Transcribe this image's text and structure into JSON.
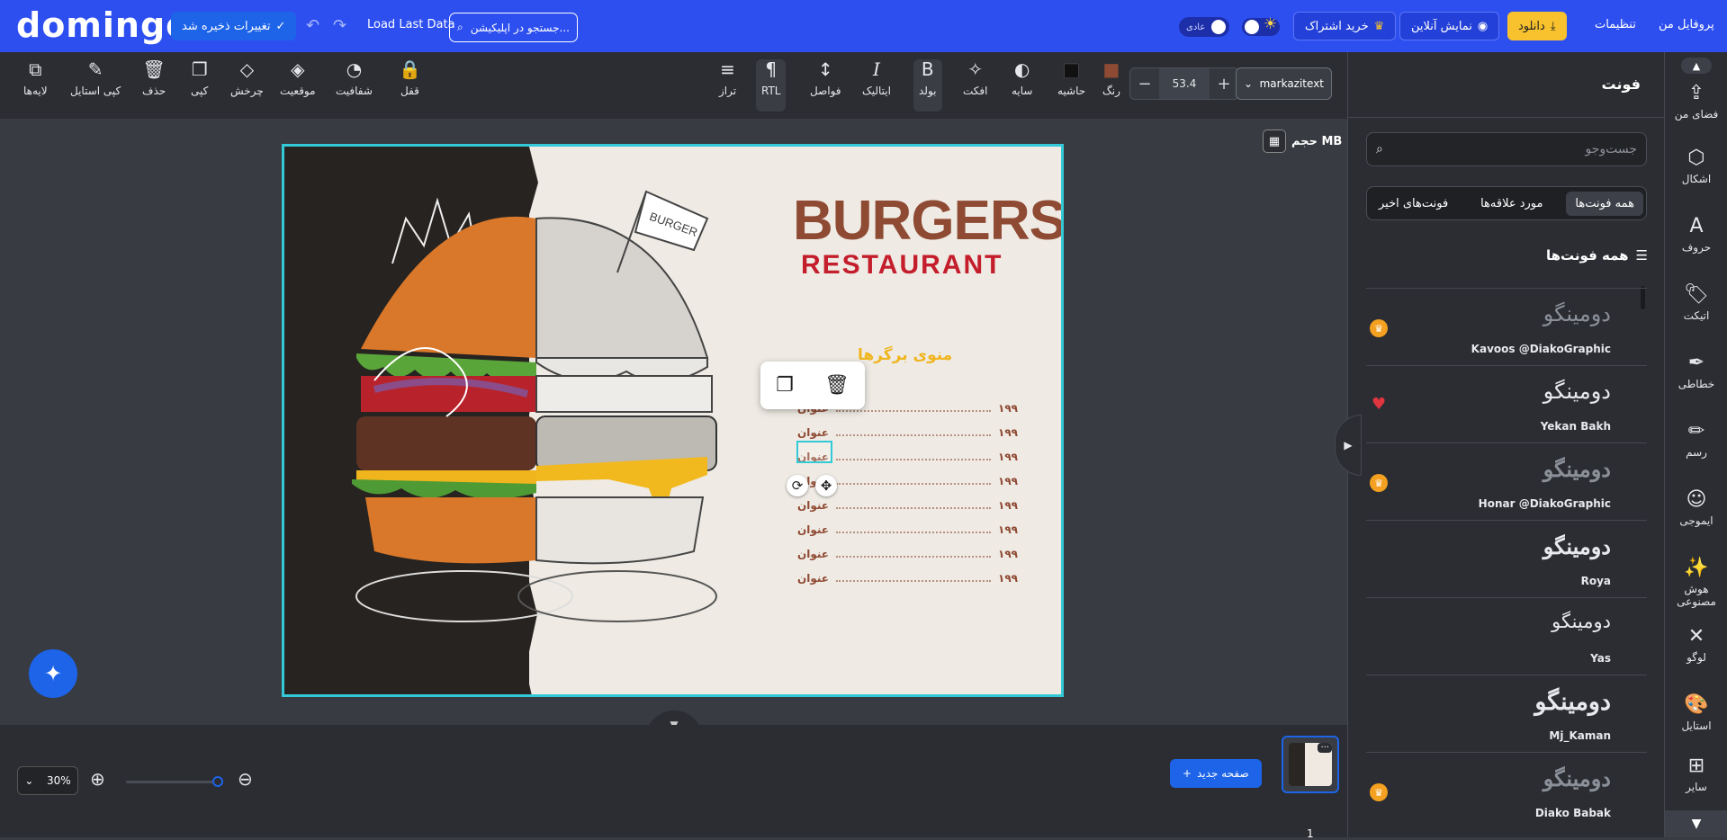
{
  "topbar": {
    "logo": "domingo",
    "save_label": "تغییرات ذخیره شد",
    "save_icon": "✓",
    "undo_icon": "↶",
    "redo_icon": "↷",
    "load_label": "Load Last Data",
    "search_placeholder": "جستجو در اپلیکیشن...",
    "theme_label": "عادی",
    "subscribe_label": "خرید اشتراک",
    "live_label": "نمایش آنلاین",
    "download_label": "دانلود",
    "settings_label": "تنظیمات",
    "profile_label": "پروفایل من",
    "colors": {
      "bar": "#2d4ff0",
      "download": "#f7c22d"
    }
  },
  "toolbar": {
    "tools_left": [
      {
        "name": "layers",
        "icon": "⧉",
        "label": "لایه‌ها"
      },
      {
        "name": "copy-style",
        "icon": "✎",
        "label": "کپی استایل"
      },
      {
        "name": "delete",
        "icon": "🗑",
        "label": "حذف"
      },
      {
        "name": "copy",
        "icon": "❐",
        "label": "کپی"
      },
      {
        "name": "rotate",
        "icon": "◇",
        "label": "چرخش"
      },
      {
        "name": "position",
        "icon": "◈",
        "label": "موقعیت"
      },
      {
        "name": "opacity",
        "icon": "◔",
        "label": "شفافیت"
      },
      {
        "name": "lock",
        "icon": "🔒",
        "label": "قفل"
      }
    ],
    "tools_right": [
      {
        "name": "align",
        "icon": "≡",
        "label": "تراز"
      },
      {
        "name": "rtl",
        "icon": "¶",
        "label": "RTL"
      },
      {
        "name": "spacing",
        "icon": "↕",
        "label": "فواصل"
      },
      {
        "name": "italic",
        "icon": "I",
        "label": "ایتالیک"
      },
      {
        "name": "bold",
        "icon": "B",
        "label": "بولد"
      },
      {
        "name": "effect",
        "icon": "✧",
        "label": "افکت"
      },
      {
        "name": "shadow",
        "icon": "◐",
        "label": "سایه"
      },
      {
        "name": "border",
        "icon": "■",
        "label": "حاشیه"
      },
      {
        "name": "color",
        "icon": "■",
        "label": "رنگ"
      }
    ],
    "font_size": "53.4",
    "font_name": "markazitext",
    "text_color": "#8f4a33"
  },
  "canvas": {
    "size_label": "حجم MB",
    "title_main": "BURGERS",
    "title_sub": "RESTAURANT",
    "menu_title": "منوی برگرها",
    "menu_rows": [
      {
        "label": "عنوان",
        "price": "۱۹۹"
      },
      {
        "label": "عنوان",
        "price": "۱۹۹"
      },
      {
        "label": "عنوان",
        "price": "۱۹۹"
      },
      {
        "label": "عنوان",
        "price": "۱۹۹"
      },
      {
        "label": "عنوان",
        "price": "۱۹۹"
      },
      {
        "label": "عنوان",
        "price": "۱۹۹"
      },
      {
        "label": "عنوان",
        "price": "۱۹۹"
      },
      {
        "label": "عنوان",
        "price": "۱۹۹"
      }
    ],
    "flag_text": "BURGER",
    "colors": {
      "title": "#8f4a33",
      "subtitle": "#c41d2b",
      "menu_title": "#f0b51d",
      "selection": "#33c9d6"
    }
  },
  "bottom": {
    "zoom_value": "30%",
    "new_page_label": "صفحه جدید",
    "page_number": "1",
    "thumb_more": "···"
  },
  "panel": {
    "title": "فونت",
    "search_placeholder": "جست‌وجو",
    "tabs": [
      "همه فونت‌ها",
      "مورد علاقه‌ها",
      "فونت‌های اخیر"
    ],
    "section_title": "همه فونت‌ها",
    "fonts": [
      {
        "sample": "دومینگو",
        "name": "Kavoos @DiakoGraphic",
        "badge": "crown"
      },
      {
        "sample": "دومینگو",
        "name": "Yekan Bakh",
        "badge": "heart"
      },
      {
        "sample": "دومینگو",
        "name": "Honar @DiakoGraphic",
        "badge": "crown"
      },
      {
        "sample": "دومینگو",
        "name": "Roya",
        "badge": ""
      },
      {
        "sample": "دومینگو",
        "name": "Yas",
        "badge": ""
      },
      {
        "sample": "دومینگو",
        "name": "Mj_Kaman",
        "badge": ""
      },
      {
        "sample": "دومینگو",
        "name": "Diako Babak",
        "badge": "crown"
      }
    ]
  },
  "rail": {
    "items": [
      {
        "icon": "⇪",
        "label": "فضای من"
      },
      {
        "icon": "⬡",
        "label": "اشکال"
      },
      {
        "icon": "A",
        "label": "حروف"
      },
      {
        "icon": "🏷",
        "label": "اتیکت"
      },
      {
        "icon": "✒",
        "label": "خطاطی"
      },
      {
        "icon": "✏",
        "label": "رسم"
      },
      {
        "icon": "☺",
        "label": "ایموجی"
      },
      {
        "icon": "✨",
        "label": "هوش مصنوعی"
      },
      {
        "icon": "✕",
        "label": "لوگو"
      },
      {
        "icon": "🎨",
        "label": "استایل"
      },
      {
        "icon": "⊞",
        "label": "سایر"
      }
    ]
  }
}
